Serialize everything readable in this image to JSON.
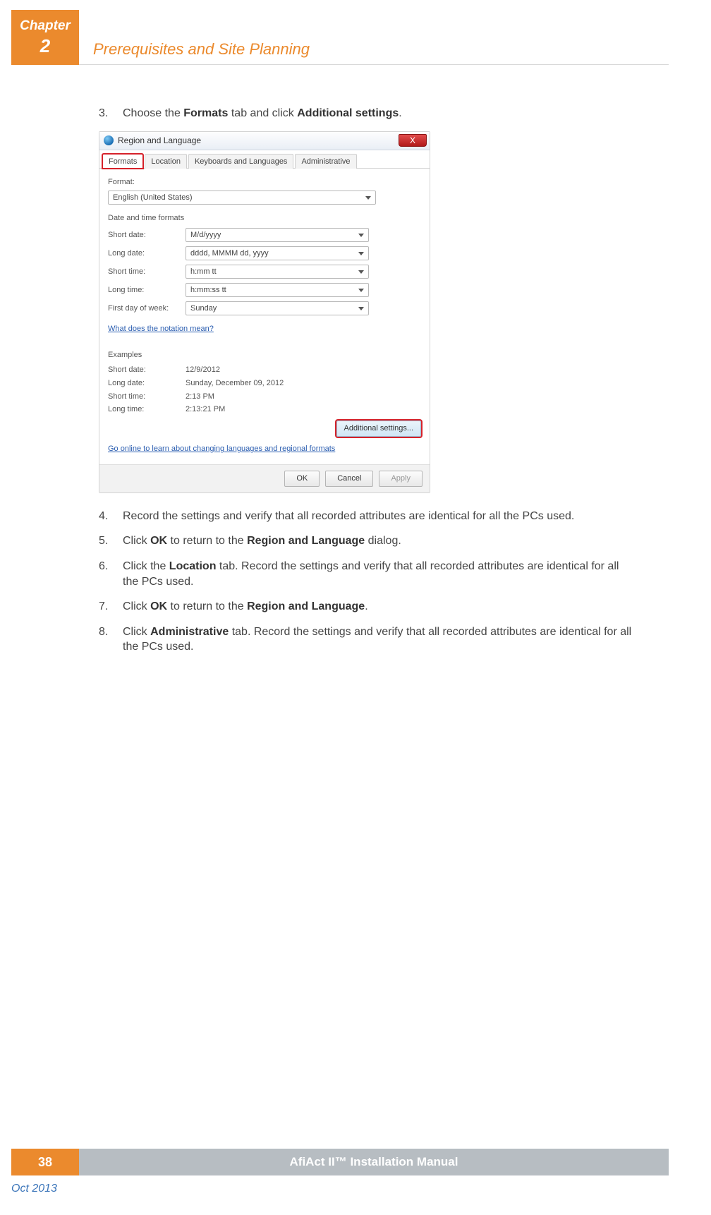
{
  "header": {
    "chapter_label": "Chapter",
    "chapter_number": "2",
    "section_title": "Prerequisites and Site Planning"
  },
  "steps": {
    "s3": {
      "n": "3.",
      "pre": "Choose the ",
      "b1": "Formats",
      "mid": " tab and click ",
      "b2": "Additional settings",
      "post": "."
    },
    "s4": {
      "n": "4.",
      "text": "Record the settings and verify that all recorded attributes are identical for all the PCs used."
    },
    "s5": {
      "n": "5.",
      "pre": "Click ",
      "b1": "OK",
      "mid": " to return to the ",
      "b2": "Region and Language",
      "post": " dialog."
    },
    "s6": {
      "n": "6.",
      "pre": "Click the ",
      "b1": "Location",
      "post": " tab. Record the settings and verify that all recorded attributes are identical for all the PCs used."
    },
    "s7": {
      "n": "7.",
      "pre": "Click ",
      "b1": "OK",
      "mid": " to return to the ",
      "b2": "Region and Language",
      "post": "."
    },
    "s8": {
      "n": "8.",
      "pre": "Click ",
      "b1": "Administrative",
      "post": " tab. Record the settings and verify that all recorded attributes are identical for all the PCs used."
    }
  },
  "screenshot": {
    "title": "Region and Language",
    "close_x": "X",
    "tabs": {
      "formats": "Formats",
      "location": "Location",
      "keyboards": "Keyboards and Languages",
      "admin": "Administrative"
    },
    "format_label": "Format:",
    "format_value": "English (United States)",
    "dtf_label": "Date and time formats",
    "fields": {
      "short_date": {
        "label": "Short date:",
        "value": "M/d/yyyy"
      },
      "long_date": {
        "label": "Long date:",
        "value": "dddd, MMMM dd, yyyy"
      },
      "short_time": {
        "label": "Short time:",
        "value": "h:mm tt"
      },
      "long_time": {
        "label": "Long time:",
        "value": "h:mm:ss tt"
      },
      "first_day": {
        "label": "First day of week:",
        "value": "Sunday"
      }
    },
    "notation_link": "What does the notation mean?",
    "examples_label": "Examples",
    "examples": {
      "short_date": {
        "label": "Short date:",
        "value": "12/9/2012"
      },
      "long_date": {
        "label": "Long date:",
        "value": "Sunday, December 09, 2012"
      },
      "short_time": {
        "label": "Short time:",
        "value": "2:13 PM"
      },
      "long_time": {
        "label": "Long time:",
        "value": "2:13:21 PM"
      }
    },
    "additional_settings": "Additional settings...",
    "online_link": "Go online to learn about changing languages and regional formats",
    "buttons": {
      "ok": "OK",
      "cancel": "Cancel",
      "apply": "Apply"
    }
  },
  "footer": {
    "page_number": "38",
    "manual_title": "AfiAct II™ Installation Manual",
    "date": "Oct 2013"
  }
}
